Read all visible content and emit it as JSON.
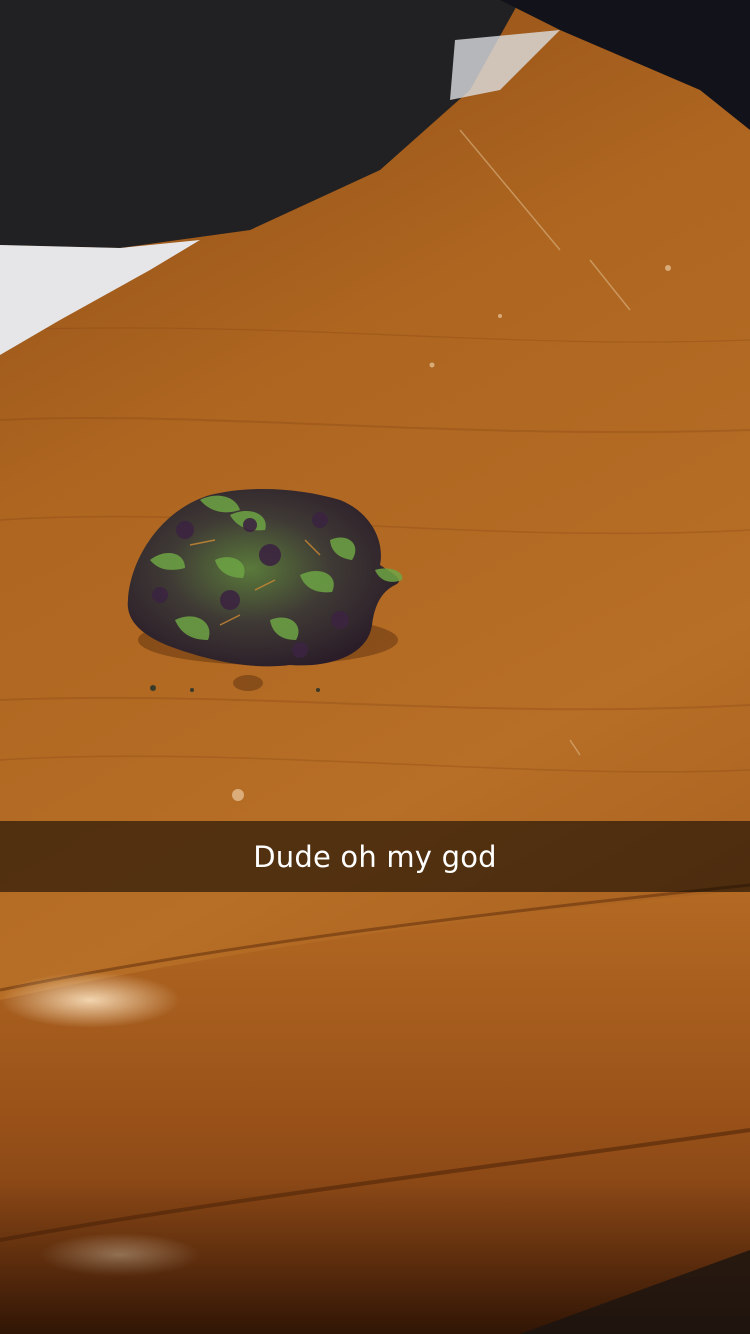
{
  "snap": {
    "caption": "Dude oh my god"
  },
  "scene": {
    "subject": "cannabis-bud",
    "surface": "wooden-table",
    "colors": {
      "wood_light": "#b86e26",
      "wood_dark": "#7a3f12",
      "fabric": "#1c1c1e",
      "paper": "#e6e6e8",
      "bud_green": "#5f8f3a",
      "bud_purple": "#3a2638"
    }
  }
}
